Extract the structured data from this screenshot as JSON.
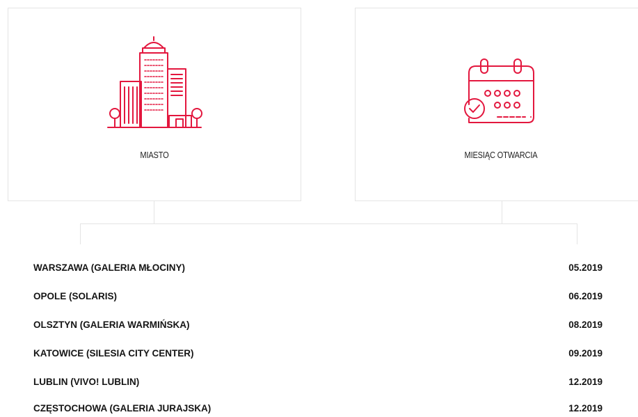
{
  "cards": {
    "city": {
      "label": "MIASTO",
      "icon": "city-buildings-icon"
    },
    "month": {
      "label": "MIESIĄC OTWARCIA",
      "icon": "calendar-icon"
    }
  },
  "colors": {
    "accent": "#e3173e",
    "border": "#e4e4e4",
    "text": "#151515"
  },
  "openings": [
    {
      "city": "WARSZAWA (GALERIA MŁOCINY)",
      "month": "05.2019"
    },
    {
      "city": "OPOLE (SOLARIS)",
      "month": "06.2019"
    },
    {
      "city": "OLSZTYN (GALERIA WARMIŃSKA)",
      "month": "08.2019"
    },
    {
      "city": "KATOWICE (SILESIA CITY CENTER)",
      "month": "09.2019"
    },
    {
      "city": "LUBLIN (VIVO! LUBLIN)",
      "month": "12.2019"
    },
    {
      "city": "CZĘSTOCHOWA (GALERIA JURAJSKA)",
      "month": "12.2019"
    }
  ]
}
